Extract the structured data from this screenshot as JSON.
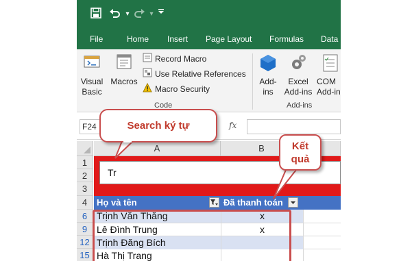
{
  "quick_access": {
    "save_icon": "save-icon",
    "undo_icon": "undo-icon",
    "redo_icon": "redo-icon",
    "customize_icon": "customize-quick-access-icon"
  },
  "tabs": [
    "File",
    "Home",
    "Insert",
    "Page Layout",
    "Formulas",
    "Data"
  ],
  "ribbon": {
    "visual_basic": [
      "Visual",
      "Basic"
    ],
    "macros": "Macros",
    "record_macro": "Record Macro",
    "relative_refs": "Use Relative References",
    "macro_security": "Macro Security",
    "code_group": "Code",
    "addins": [
      "Add-",
      "ins"
    ],
    "excel_addins": [
      "Excel",
      "Add-ins"
    ],
    "com_addins": [
      "COM",
      "Add-in"
    ],
    "addins_group": "Add-ins"
  },
  "formula_bar": {
    "name_box": "F24",
    "fx": "fx",
    "formula": ""
  },
  "columns": [
    "A",
    "B"
  ],
  "rows": [
    "1",
    "2",
    "3",
    "4",
    "6",
    "9",
    "12",
    "15"
  ],
  "search_value": "Tr",
  "table": {
    "headers": [
      "Họ và tên",
      "Đã thanh toán"
    ],
    "rows": [
      {
        "name": "Trịnh Văn Thăng",
        "paid": "x"
      },
      {
        "name": "Lê Đình Trung",
        "paid": "x"
      },
      {
        "name": "Trịnh Đăng Bích",
        "paid": ""
      },
      {
        "name": "Hà Thị Trang",
        "paid": ""
      }
    ]
  },
  "callouts": {
    "search": "Search ký tự",
    "result": [
      "Kết",
      "quả"
    ]
  },
  "colors": {
    "excel_green": "#217346",
    "table_header": "#4472c4",
    "table_band": "#d9e1f2",
    "search_band": "#e11919",
    "annotation": "#c94e4e"
  }
}
